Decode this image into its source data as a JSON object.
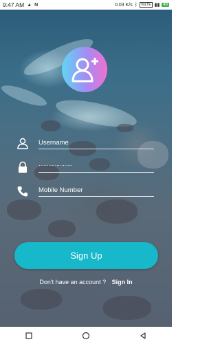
{
  "status_bar": {
    "time": "9:47 AM",
    "network_speed": "0.03 K/s",
    "volte": "VoLTE",
    "battery": "46"
  },
  "form": {
    "username_placeholder": "Username",
    "password_value": "…………………",
    "mobile_placeholder": "Mobile Number",
    "signup_label": "Sign Up"
  },
  "footer": {
    "question": "Don't have an account ?",
    "signin_label": "Sign In"
  },
  "colors": {
    "button": "#17b8c9",
    "avatar_gradient_start": "#5fd6f5",
    "avatar_gradient_end": "#f36fd2"
  },
  "icons": [
    "add-user-icon",
    "person-icon",
    "lock-icon",
    "phone-icon",
    "back-icon",
    "home-icon",
    "recents-icon"
  ]
}
